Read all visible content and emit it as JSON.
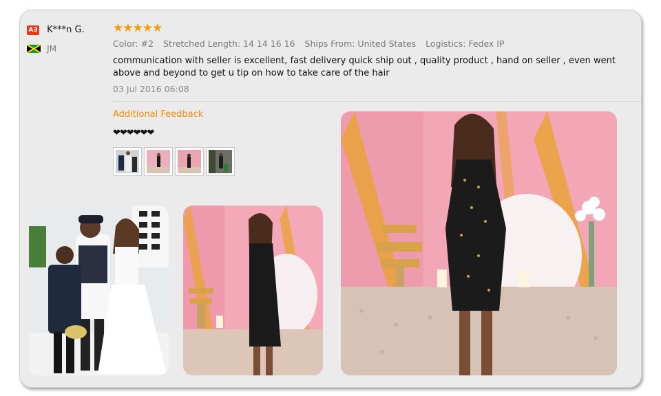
{
  "reviewer": {
    "level": "A3",
    "name": "K***n G.",
    "country_code": "JM"
  },
  "review": {
    "stars": "★★★★★",
    "specs": {
      "color": "Color: #2",
      "length": "Stretched Length: 14 14 16 16",
      "ships_from": "Ships From: United States",
      "logistics": "Logistics: Fedex IP"
    },
    "text": "communication with seller is excellent, fast delivery quick ship out , quality product , hand on seller , even went above and beyond to get u tip on how to take care of the hair",
    "date": "03 Jul 2016 06:08"
  },
  "additional": {
    "title": "Additional Feedback",
    "hearts": "❤❤❤❤❤❤"
  },
  "colors": {
    "accent": "#f08c00",
    "star": "#f59b00",
    "badge": "#e23a1d"
  }
}
